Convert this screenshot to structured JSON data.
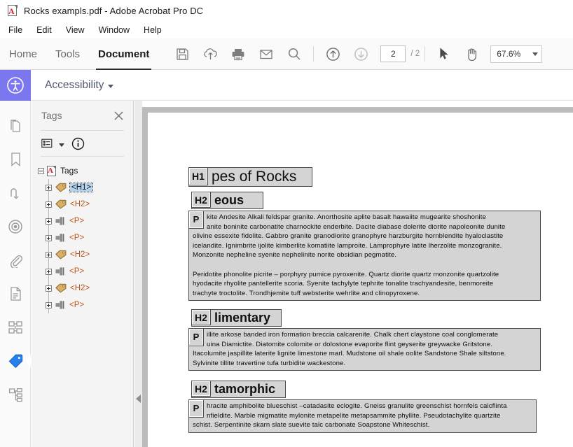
{
  "window": {
    "title": "Rocks exampls.pdf - Adobe Acrobat Pro DC",
    "app_icon": "pdf-file-icon"
  },
  "menubar": {
    "items": [
      {
        "label": "File"
      },
      {
        "label": "Edit"
      },
      {
        "label": "View"
      },
      {
        "label": "Window"
      },
      {
        "label": "Help"
      }
    ]
  },
  "toolbar": {
    "tabs": [
      {
        "label": "Home",
        "active": false
      },
      {
        "label": "Tools",
        "active": false
      },
      {
        "label": "Document",
        "active": true
      }
    ],
    "icons": [
      {
        "name": "save-icon"
      },
      {
        "name": "upload-cloud-icon"
      },
      {
        "name": "print-icon"
      },
      {
        "name": "email-icon"
      },
      {
        "name": "search-icon"
      },
      {
        "name": "previous-page-icon"
      },
      {
        "name": "next-page-icon"
      },
      {
        "name": "select-tool-icon"
      },
      {
        "name": "hand-tool-icon"
      }
    ],
    "page_current": "2",
    "page_total": "/ 2",
    "zoom_value": "67.6%"
  },
  "accessibility_bar": {
    "icon": "accessibility-icon",
    "title": "Accessibility",
    "accent": "#7b77ee"
  },
  "rail": {
    "items": [
      {
        "name": "page-thumbnails-icon",
        "selected": false
      },
      {
        "name": "bookmarks-icon",
        "selected": false
      },
      {
        "name": "reflow-icon",
        "selected": false
      },
      {
        "name": "target-icon",
        "selected": false
      },
      {
        "name": "attachments-icon",
        "selected": false
      },
      {
        "name": "content-icon",
        "selected": false
      },
      {
        "name": "order-icon",
        "selected": false
      },
      {
        "name": "tags-icon",
        "selected": true
      },
      {
        "name": "structure-tree-icon",
        "selected": false
      }
    ],
    "selected_color": "#2680eb"
  },
  "tags_panel": {
    "title": "Tags",
    "close_icon": "close-icon",
    "options_icon": "options-menu-icon",
    "info_icon": "info-icon",
    "tree": [
      {
        "level": 0,
        "label": "Tags",
        "expander": "minus",
        "icon": "pdf-tag-root-icon",
        "selected": false
      },
      {
        "level": 1,
        "label": "<H1>",
        "expander": "plus",
        "icon": "tag-icon",
        "selected": true
      },
      {
        "level": 1,
        "label": "<H2>",
        "expander": "plus",
        "icon": "tag-icon",
        "selected": false
      },
      {
        "level": 1,
        "label": "<P>",
        "expander": "plus",
        "icon": "paragraph-icon",
        "selected": false
      },
      {
        "level": 1,
        "label": "<P>",
        "expander": "plus",
        "icon": "paragraph-icon",
        "selected": false
      },
      {
        "level": 1,
        "label": "<H2>",
        "expander": "plus",
        "icon": "tag-icon",
        "selected": false
      },
      {
        "level": 1,
        "label": "<P>",
        "expander": "plus",
        "icon": "paragraph-icon",
        "selected": false
      },
      {
        "level": 1,
        "label": "<H2>",
        "expander": "plus",
        "icon": "tag-icon",
        "selected": false
      },
      {
        "level": 1,
        "label": "<P>",
        "expander": "plus",
        "icon": "paragraph-icon",
        "selected": false
      }
    ]
  },
  "document": {
    "h1": {
      "badge": "H1",
      "text": "pes of Rocks"
    },
    "section_igneous": {
      "heading": {
        "badge": "H2",
        "text": "eous"
      },
      "paragraph": {
        "badge": "P",
        "line1": "kite Andesite Alkali feldspar granite. Anorthosite aplite basalt hawaiite mugearite shoshonite",
        "line2": "anite boninite carbonatite charnockite enderbite. Dacite diabase dolerite diorite napoleonite dunite",
        "line3": "olivine essexite fidolite. Gabbro granite granodiorite granophyre harzburgite hornblendite hyaloclastite",
        "line4": "icelandite. Ignimbrite ijolite kimberlite komatiite lamproite. Lamprophyre latite lherzolite monzogranite.",
        "line5": "Monzonite nepheline syenite nephelinite norite obsidian pegmatite.",
        "line6": "Peridotite phonolite picrite – porphyry pumice pyroxenite. Quartz diorite quartz monzonite quartzolite",
        "line7": "hyodacite rhyolite pantellerite scoria. Syenite tachylyte tephrite tonalite trachyandesite, benmoreite",
        "line8": "trachyte troctolite. Trondhjemite tuff websterite wehrlite and clinopyroxene."
      }
    },
    "section_sedimentary": {
      "heading": {
        "badge": "H2",
        "text": "limentary"
      },
      "paragraph": {
        "badge": "P",
        "line1": "illite arkose banded iron formation breccia calcarenite. Chalk chert claystone coal conglomerate",
        "line2": "uina Diamictite. Diatomite colomite or dolostone evaporite flint geyserite greywacke Gritstone.",
        "line3": "Itacolumite jaspillite laterite lignite limestone marl. Mudstone oil shale oolite Sandstone Shale siltstone.",
        "line4": "Sylvinite tillite travertine tufa turbidite wackestone."
      }
    },
    "section_metamorphic": {
      "heading": {
        "badge": "H2",
        "text": "tamorphic"
      },
      "paragraph": {
        "badge": "P",
        "line1": "hracite amphibolite blueschist –catadasite eclogite. Gneiss granulite greenschist hornfels calcflinta",
        "line2": "nfieldite. Marble migmatite mylonite metapelite metapsammite phyllite. Pseudotachylite quartzite",
        "line3": "schist. Serpentinite skarn slate suevite talc carbonate Soapstone Whiteschist."
      }
    }
  }
}
